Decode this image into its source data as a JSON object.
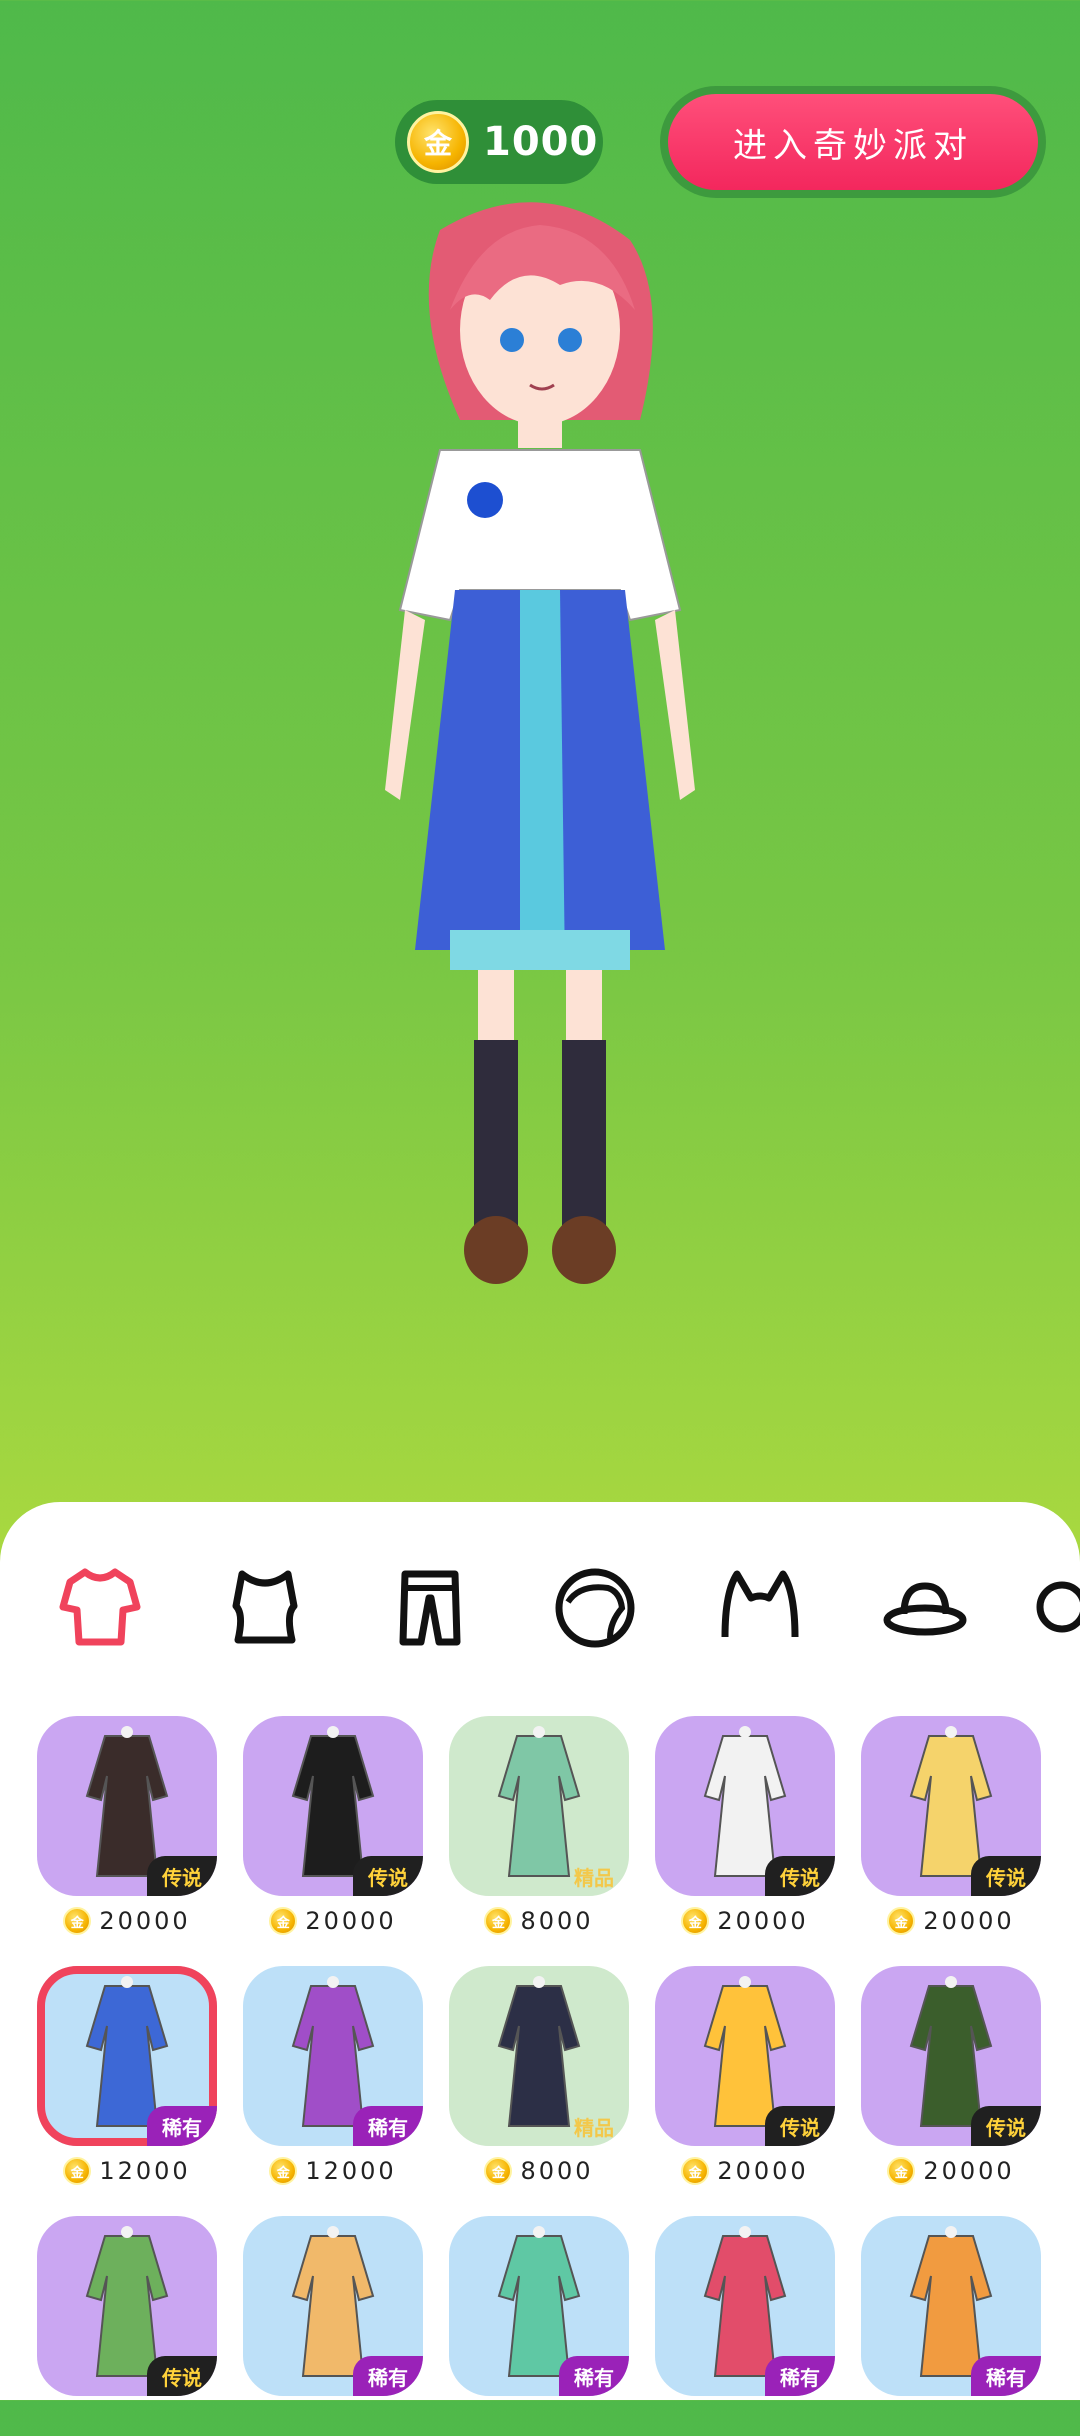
{
  "hud": {
    "coin_symbol": "金",
    "coin_amount": "1000",
    "party_button": "进入奇妙派对"
  },
  "tabs": [
    {
      "name": "outfit",
      "icon": "outfit-icon",
      "active": true
    },
    {
      "name": "top",
      "icon": "top-icon",
      "active": false
    },
    {
      "name": "bottom",
      "icon": "pants-icon",
      "active": false
    },
    {
      "name": "hair",
      "icon": "hair-icon",
      "active": false
    },
    {
      "name": "headwear",
      "icon": "cat-ears-icon",
      "active": false
    },
    {
      "name": "hat",
      "icon": "hat-icon",
      "active": false
    }
  ],
  "items": [
    {
      "bg": "purple",
      "badge": "传说",
      "badge_type": "legend",
      "price": "20000",
      "selected": false
    },
    {
      "bg": "purple",
      "badge": "传说",
      "badge_type": "legend",
      "price": "20000",
      "selected": false
    },
    {
      "bg": "green",
      "badge": "精品",
      "badge_type": "fine",
      "price": "8000",
      "selected": false
    },
    {
      "bg": "purple",
      "badge": "传说",
      "badge_type": "legend",
      "price": "20000",
      "selected": false
    },
    {
      "bg": "purple",
      "badge": "传说",
      "badge_type": "legend",
      "price": "20000",
      "selected": false
    },
    {
      "bg": "blue",
      "badge": "稀有",
      "badge_type": "rare",
      "price": "12000",
      "selected": true
    },
    {
      "bg": "blue",
      "badge": "稀有",
      "badge_type": "rare",
      "price": "12000",
      "selected": false
    },
    {
      "bg": "green",
      "badge": "精品",
      "badge_type": "fine",
      "price": "8000",
      "selected": false
    },
    {
      "bg": "purple",
      "badge": "传说",
      "badge_type": "legend",
      "price": "20000",
      "selected": false
    },
    {
      "bg": "purple",
      "badge": "传说",
      "badge_type": "legend",
      "price": "20000",
      "selected": false
    },
    {
      "bg": "purple",
      "badge": "传说",
      "badge_type": "legend",
      "price": "",
      "selected": false
    },
    {
      "bg": "blue",
      "badge": "稀有",
      "badge_type": "rare",
      "price": "",
      "selected": false
    },
    {
      "bg": "blue",
      "badge": "稀有",
      "badge_type": "rare",
      "price": "",
      "selected": false
    },
    {
      "bg": "blue",
      "badge": "稀有",
      "badge_type": "rare",
      "price": "",
      "selected": false
    },
    {
      "bg": "blue",
      "badge": "稀有",
      "badge_type": "rare",
      "price": "",
      "selected": false
    }
  ],
  "colors": {
    "accent": "#f3275d",
    "selected_outline": "#f0435c",
    "active_tab": "#f0435c"
  }
}
